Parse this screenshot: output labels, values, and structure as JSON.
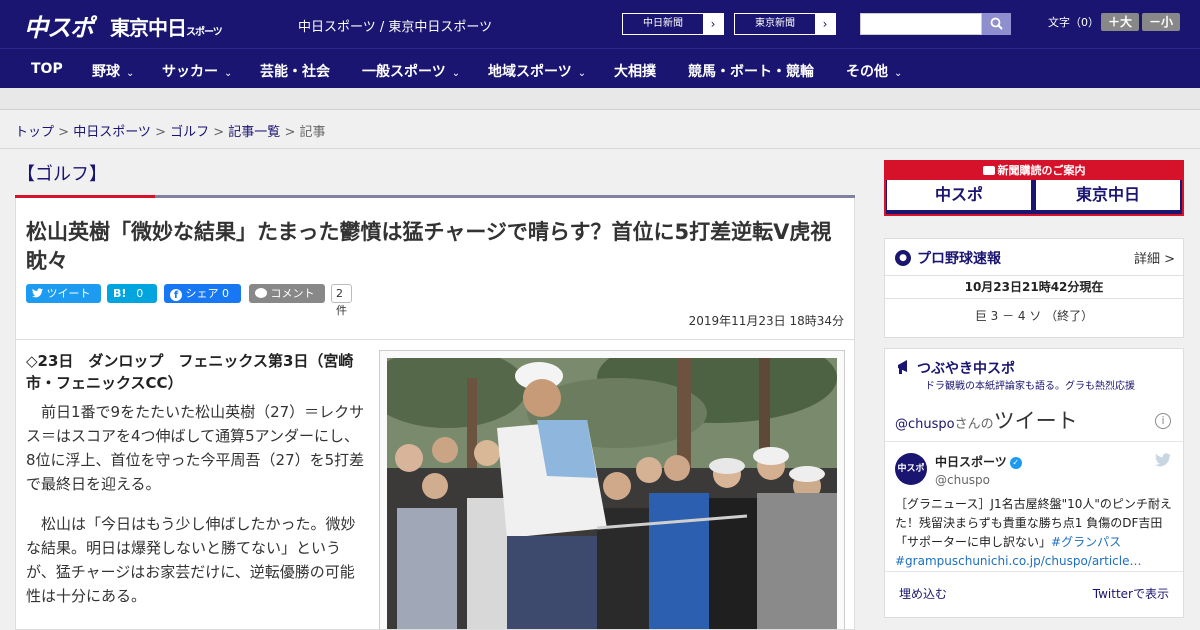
{
  "header": {
    "logo_chuspo": "中スポ",
    "logo_tokyo": "東京中日",
    "logo_tokyo_sub": "スポーツ",
    "site_names": "中日スポーツ / 東京中日スポーツ",
    "paper_buttons": [
      {
        "label": "中日新聞",
        "arrow": "›"
      },
      {
        "label": "東京新聞",
        "arrow": "›"
      }
    ],
    "font_size_label": "文字（0）",
    "font_plus": "＋大",
    "font_minus": "－小",
    "brand_color": "#1a1570",
    "accent_color": "#d6122b"
  },
  "nav": {
    "items": [
      {
        "label": "TOP",
        "dropdown": false
      },
      {
        "label": "野球",
        "dropdown": true
      },
      {
        "label": "サッカー",
        "dropdown": true
      },
      {
        "label": "芸能・社会",
        "dropdown": false
      },
      {
        "label": "一般スポーツ",
        "dropdown": true
      },
      {
        "label": "地域スポーツ",
        "dropdown": true
      },
      {
        "label": "大相撲",
        "dropdown": false
      },
      {
        "label": "競馬・ボート・競輪",
        "dropdown": false
      },
      {
        "label": "その他",
        "dropdown": true
      }
    ],
    "chevron": "⌄"
  },
  "breadcrumb": {
    "items": [
      "トップ",
      "中日スポーツ",
      "ゴルフ",
      "記事一覧"
    ],
    "current": "記事",
    "separator": " > "
  },
  "article": {
    "category": "【ゴルフ】",
    "headline": "松山英樹「微妙な結果」たまった鬱憤は猛チャージで晴らす？首位に5打差逆転V虎視眈々",
    "share": {
      "tweet_label": "ツイート",
      "hatena_label": "B!",
      "hatena_count": "0",
      "facebook_label": "シェア 0",
      "comment_label": "コメント",
      "comment_count": "2件"
    },
    "date": "2019年11月23日 18時34分",
    "lead": "◇23日　ダンロップ　フェニックス第3日（宮崎市・フェニックスCC）",
    "paragraphs": [
      "前日1番で9をたたいた松山英樹（27）＝レクサス＝はスコアを4つ伸ばして通算5アンダーにし、8位に浮上、首位を守った今平周吾（27）を5打差で最終日を迎える。",
      "松山は「今日はもう少し伸ばしたかった。微妙な結果。明日は爆発しないと勝てない」というが、猛チャージはお家芸だけに、逆転優勝の可能性は十分にある。"
    ]
  },
  "sidebar": {
    "ad_title": "新聞購読のご案内",
    "ad_logo_1": "中スポ",
    "ad_logo_2": "東京中日",
    "baseball": {
      "title": "プロ野球速報",
      "detail_link": "詳細 >",
      "as_of": "10月23日21時42分現在",
      "score": "巨 3 － 4 ソ （終了）"
    },
    "twitter": {
      "title": "つぶやき中スポ",
      "subtitle": "ドラ観戦の本紙評論家も語る。グラも熱烈応援",
      "handle_prefix": "@chuspo",
      "handle_suffix": "さんの",
      "tweets_word": "ツイート",
      "account_name": "中日スポーツ",
      "account_handle": "@chuspo",
      "avatar_text": "中スポ",
      "tweet_text": "［グラニュース］J1名古屋終盤\"10人\"のピンチ耐えた！残留決まらずも貴重な勝ち点1 負傷のDF吉田「サポーターに申し訳ない」",
      "tweet_tag": "#グランパス",
      "tweet_link": "#grampuschunichi.co.jp/chuspo/article…",
      "embed": "埋め込む",
      "view_on": "Twitterで表示"
    }
  }
}
